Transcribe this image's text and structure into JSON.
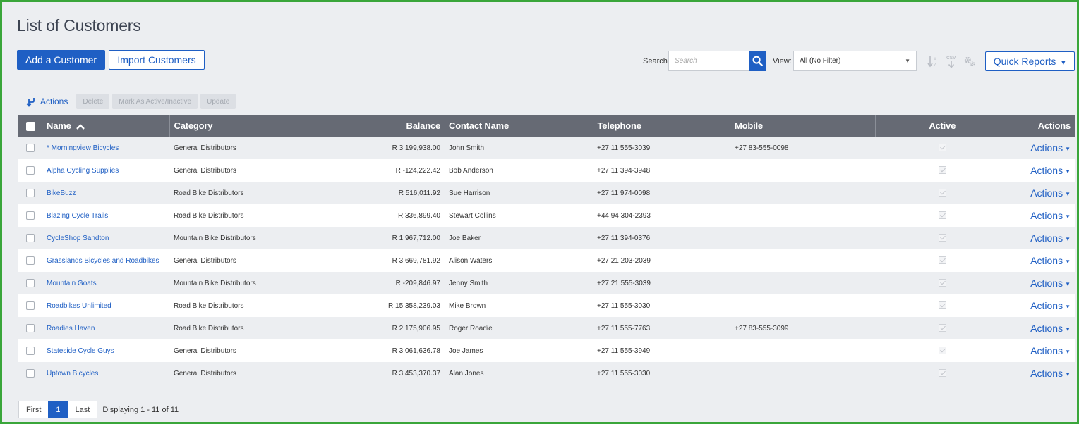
{
  "page": {
    "title": "List of Customers"
  },
  "toolbar": {
    "add_label": "Add a Customer",
    "import_label": "Import Customers",
    "search_label": "Search:",
    "search_placeholder": "Search",
    "view_label": "View:",
    "view_value": "All (No Filter)",
    "quick_reports_label": "Quick Reports",
    "icons": [
      "sort-icon",
      "csv-export-icon",
      "settings-icon"
    ],
    "accent_color": "#1f5fc4"
  },
  "bulk": {
    "actions_label": "Actions",
    "delete_label": "Delete",
    "mark_label": "Mark As Active/Inactive",
    "update_label": "Update"
  },
  "table": {
    "columns": [
      "Name",
      "Category",
      "Balance",
      "Contact Name",
      "Telephone",
      "Mobile",
      "Active",
      "Actions"
    ],
    "sort": {
      "column": "Name",
      "direction": "ascending"
    },
    "header_color": "#666a74",
    "action_label": "Actions",
    "rows": [
      {
        "name": "* Morningview Bicycles",
        "category": "General Distributors",
        "balance": "R 3,199,938.00",
        "contact": "John Smith",
        "telephone": "+27 11 555-3039",
        "mobile": "+27 83-555-0098",
        "active": true
      },
      {
        "name": "Alpha Cycling Supplies",
        "category": "General Distributors",
        "balance": "R -124,222.42",
        "contact": "Bob Anderson",
        "telephone": "+27 11 394-3948",
        "mobile": "",
        "active": true
      },
      {
        "name": "BikeBuzz",
        "category": "Road Bike Distributors",
        "balance": "R 516,011.92",
        "contact": "Sue Harrison",
        "telephone": "+27 11 974-0098",
        "mobile": "",
        "active": true
      },
      {
        "name": "Blazing Cycle Trails",
        "category": "Road Bike Distributors",
        "balance": "R 336,899.40",
        "contact": "Stewart Collins",
        "telephone": "+44 94 304-2393",
        "mobile": "",
        "active": true
      },
      {
        "name": "CycleShop Sandton",
        "category": "Mountain Bike Distributors",
        "balance": "R 1,967,712.00",
        "contact": "Joe Baker",
        "telephone": "+27 11 394-0376",
        "mobile": "",
        "active": true
      },
      {
        "name": "Grasslands Bicycles and Roadbikes",
        "category": "General Distributors",
        "balance": "R 3,669,781.92",
        "contact": "Alison Waters",
        "telephone": "+27 21 203-2039",
        "mobile": "",
        "active": true
      },
      {
        "name": "Mountain Goats",
        "category": "Mountain Bike Distributors",
        "balance": "R -209,846.97",
        "contact": "Jenny Smith",
        "telephone": "+27 21 555-3039",
        "mobile": "",
        "active": true
      },
      {
        "name": "Roadbikes Unlimited",
        "category": "Road Bike Distributors",
        "balance": "R 15,358,239.03",
        "contact": "Mike Brown",
        "telephone": "+27 11 555-3030",
        "mobile": "",
        "active": true
      },
      {
        "name": "Roadies Haven",
        "category": "Road Bike Distributors",
        "balance": "R 2,175,906.95",
        "contact": "Roger Roadie",
        "telephone": "+27 11 555-7763",
        "mobile": "+27 83-555-3099",
        "active": true
      },
      {
        "name": "Stateside Cycle Guys",
        "category": "General Distributors",
        "balance": "R 3,061,636.78",
        "contact": "Joe James",
        "telephone": "+27 11 555-3949",
        "mobile": "",
        "active": true
      },
      {
        "name": "Uptown Bicycles",
        "category": "General Distributors",
        "balance": "R 3,453,370.37",
        "contact": "Alan Jones",
        "telephone": "+27 11 555-3030",
        "mobile": "",
        "active": true
      }
    ]
  },
  "pager": {
    "first_label": "First",
    "current_page": "1",
    "last_label": "Last",
    "info": "Displaying 1 - 11 of 11"
  }
}
